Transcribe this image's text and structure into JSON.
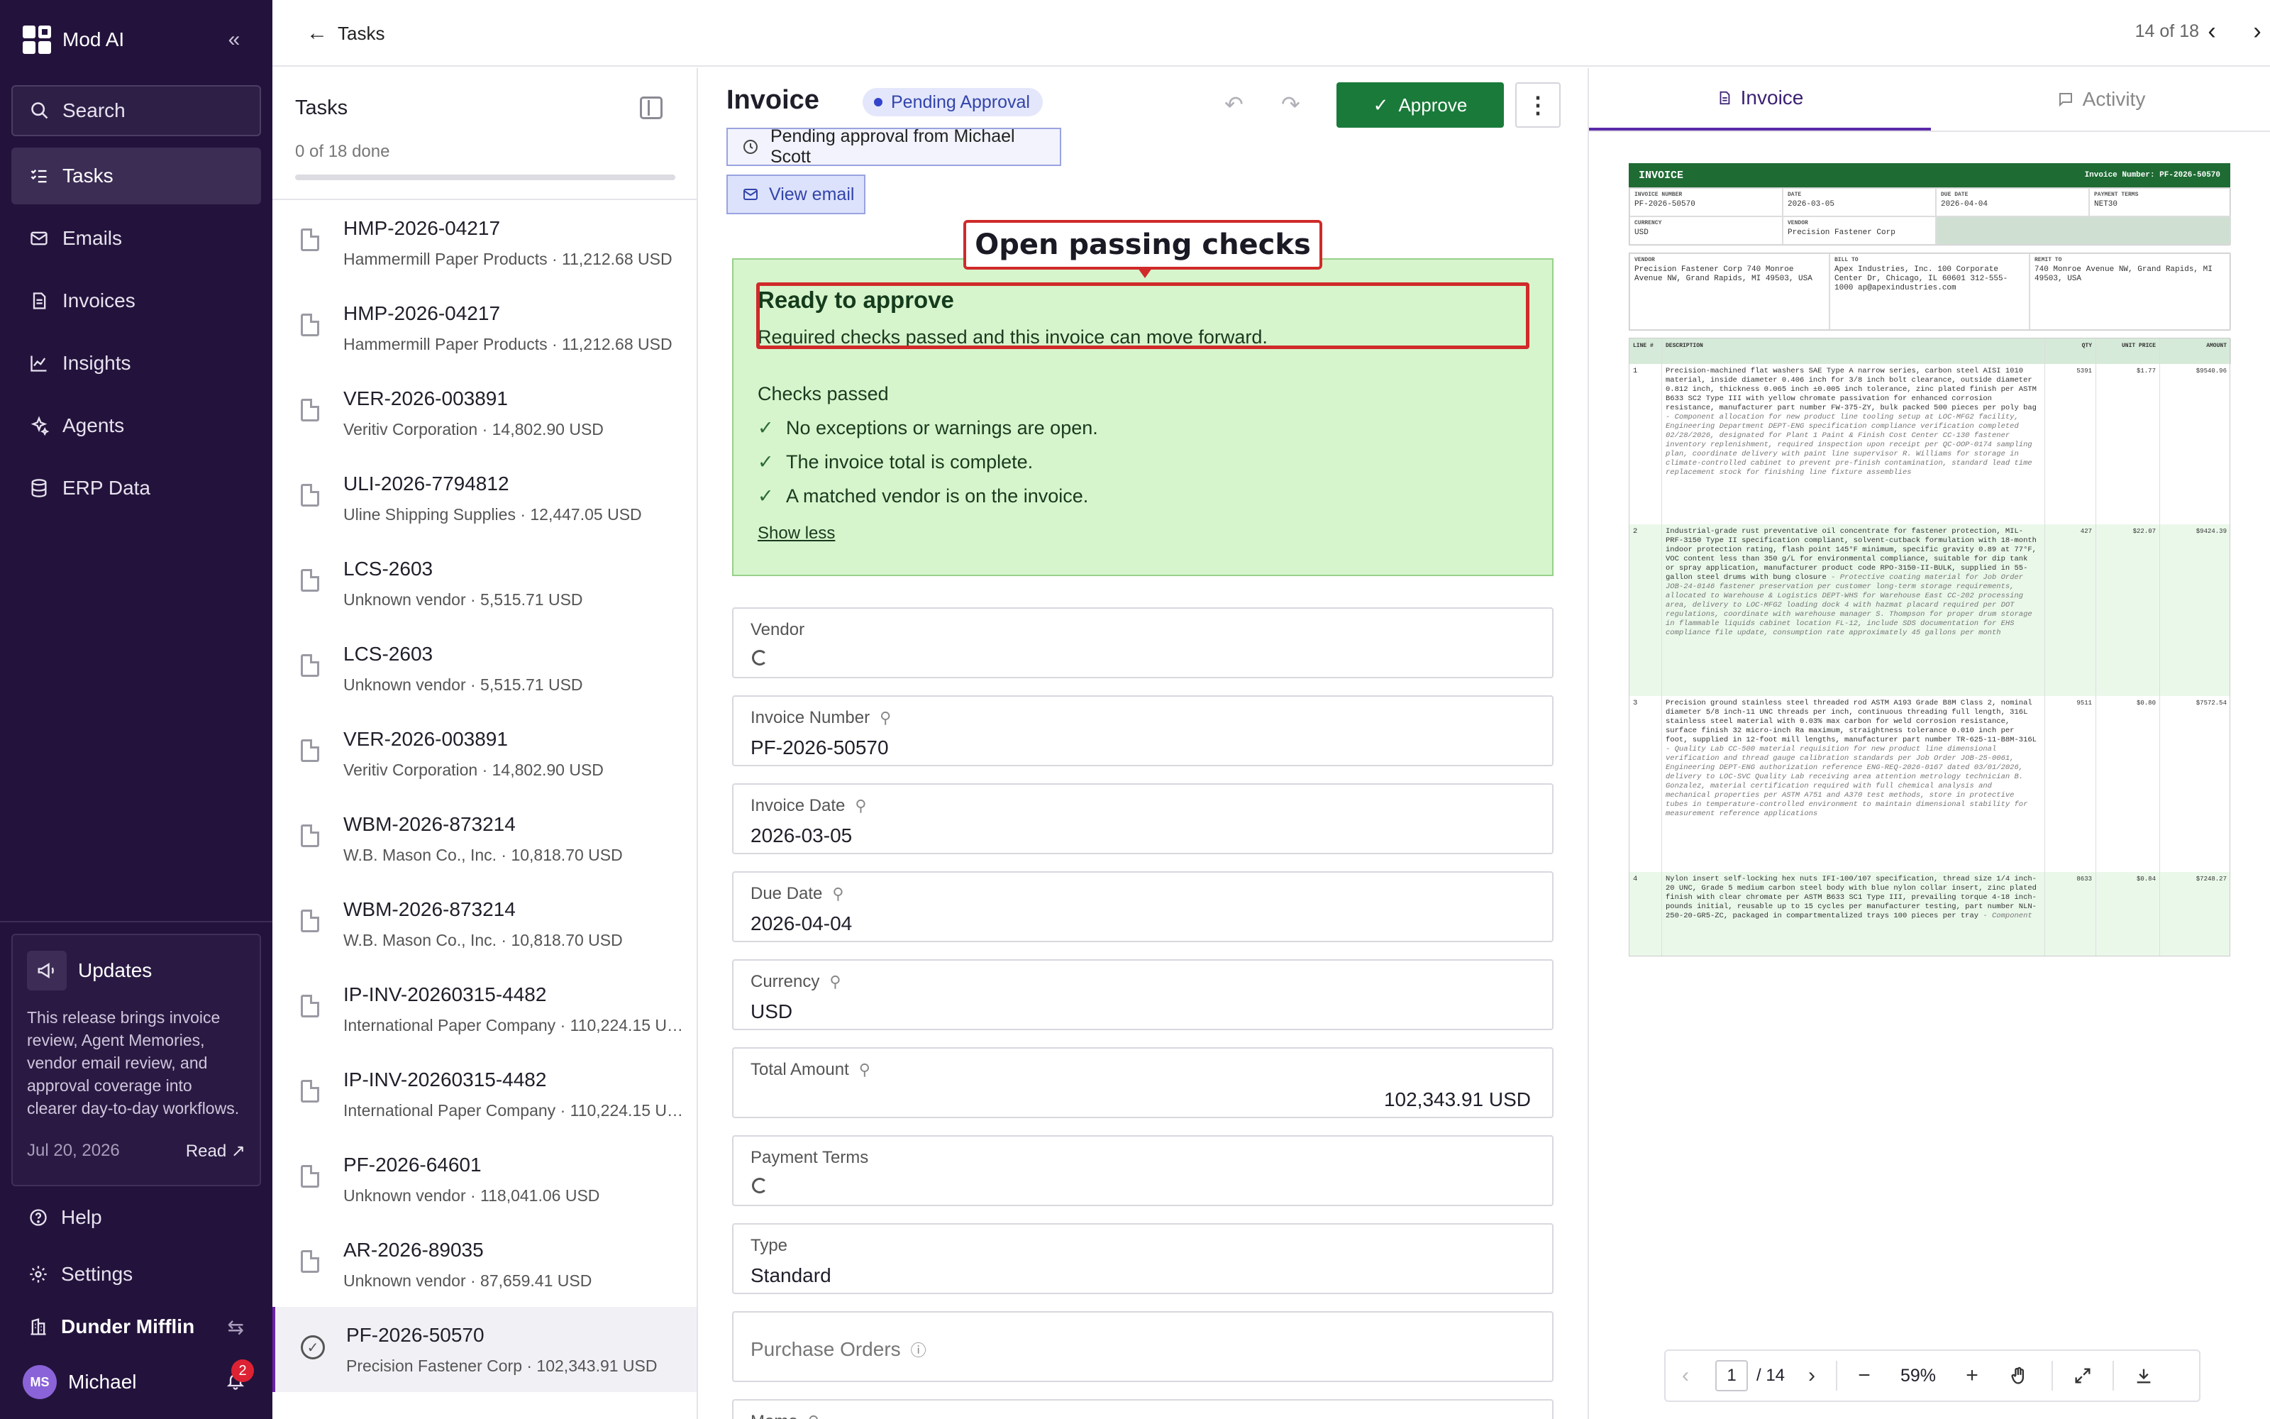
{
  "app": {
    "name": "Mod AI",
    "search_label": "Search"
  },
  "nav": [
    {
      "label": "Tasks",
      "icon": "tasks-icon",
      "active": true
    },
    {
      "label": "Emails",
      "icon": "mail-icon"
    },
    {
      "label": "Invoices",
      "icon": "invoice-icon"
    },
    {
      "label": "Insights",
      "icon": "chart-icon"
    },
    {
      "label": "Agents",
      "icon": "agents-icon"
    },
    {
      "label": "ERP Data",
      "icon": "database-icon"
    }
  ],
  "updates": {
    "title": "Updates",
    "body": "This release brings invoice review, Agent Memories, vendor email review, and approval coverage into clearer day-to-day workflows.",
    "date": "Jul 20, 2026",
    "read_label": "Read ↗"
  },
  "footer_nav": {
    "help": "Help",
    "settings": "Settings",
    "org": "Dunder Mifflin",
    "user_initials": "MS",
    "user_name": "Michael",
    "notification_count": "2"
  },
  "topbar": {
    "back_label": "Tasks",
    "pager_text": "14 of 18"
  },
  "tasks": {
    "title": "Tasks",
    "done_text": "0 of 18 done",
    "progress": 0,
    "items": [
      {
        "title": "HMP-2026-04217",
        "sub": "Hammermill Paper Products · 11,212.68 USD"
      },
      {
        "title": "HMP-2026-04217",
        "sub": "Hammermill Paper Products · 11,212.68 USD"
      },
      {
        "title": "VER-2026-003891",
        "sub": "Veritiv Corporation · 14,802.90 USD"
      },
      {
        "title": "ULI-2026-7794812",
        "sub": "Uline Shipping Supplies · 12,447.05 USD"
      },
      {
        "title": "LCS-2603",
        "sub": "Unknown vendor · 5,515.71 USD"
      },
      {
        "title": "LCS-2603",
        "sub": "Unknown vendor · 5,515.71 USD"
      },
      {
        "title": "VER-2026-003891",
        "sub": "Veritiv Corporation · 14,802.90 USD"
      },
      {
        "title": "WBM-2026-873214",
        "sub": "W.B. Mason Co., Inc. · 10,818.70 USD"
      },
      {
        "title": "WBM-2026-873214",
        "sub": "W.B. Mason Co., Inc. · 10,818.70 USD"
      },
      {
        "title": "IP-INV-20260315-4482",
        "sub": "International Paper Company · 110,224.15 USD"
      },
      {
        "title": "IP-INV-20260315-4482",
        "sub": "International Paper Company · 110,224.15 USD"
      },
      {
        "title": "PF-2026-64601",
        "sub": "Unknown vendor · 118,041.06 USD"
      },
      {
        "title": "AR-2026-89035",
        "sub": "Unknown vendor · 87,659.41 USD"
      },
      {
        "title": "PF-2026-50570",
        "sub": "Precision Fastener Corp · 102,343.91 USD",
        "selected": true
      }
    ]
  },
  "invoice": {
    "title": "Invoice",
    "status": "Pending Approval",
    "approve_label": "Approve",
    "pending_text": "Pending approval from Michael Scott",
    "view_email_label": "View email",
    "checks": {
      "ready_title": "Ready to approve",
      "ready_sub": "Required checks passed and this invoice can move forward.",
      "passed_title": "Checks passed",
      "items": [
        "No exceptions or warnings are open.",
        "The invoice total is complete.",
        "A matched vendor is on the invoice."
      ],
      "show_less": "Show less"
    },
    "annotation": "Open passing checks",
    "fields": [
      {
        "label": "Vendor",
        "value": "",
        "loading": true
      },
      {
        "label": "Invoice Number",
        "value": "PF-2026-50570",
        "search": true
      },
      {
        "label": "Invoice Date",
        "value": "2026-03-05",
        "search": true
      },
      {
        "label": "Due Date",
        "value": "2026-04-04",
        "search": true
      },
      {
        "label": "Currency",
        "value": "USD",
        "search": true
      },
      {
        "label": "Total Amount",
        "value": "102,343.91 USD",
        "search": true
      },
      {
        "label": "Payment Terms",
        "value": "",
        "loading": true
      },
      {
        "label": "Type",
        "value": "Standard"
      },
      {
        "label": "Purchase Orders",
        "value": ""
      },
      {
        "label": "Memo",
        "value": "",
        "search": true
      }
    ]
  },
  "right": {
    "tab_invoice": "Invoice",
    "tab_activity": "Activity",
    "page_current": "1",
    "page_total": "/ 14",
    "zoom": "59%"
  },
  "document": {
    "header_title": "INVOICE",
    "header_number": "Invoice Number: PF-2026-50570",
    "meta": [
      {
        "k": "INVOICE NUMBER",
        "v": "PF-2026-50570"
      },
      {
        "k": "DATE",
        "v": "2026-03-05"
      },
      {
        "k": "DUE DATE",
        "v": "2026-04-04"
      },
      {
        "k": "PAYMENT TERMS",
        "v": "NET30"
      },
      {
        "k": "CURRENCY",
        "v": "USD"
      },
      {
        "k": "VENDOR",
        "v": "Precision Fastener Corp"
      }
    ],
    "vendor": {
      "k": "VENDOR",
      "v": "Precision Fastener Corp 740 Monroe Avenue NW, Grand Rapids, MI 49503, USA"
    },
    "bill_to": {
      "k": "BILL TO",
      "v": "Apex Industries, Inc. 100 Corporate Center Dr, Chicago, IL 60601 312-555-1000 ap@apexindustries.com"
    },
    "remit_to": {
      "k": "REMIT TO",
      "v": "740 Monroe Avenue NW, Grand Rapids, MI 49503, USA"
    },
    "columns": [
      "LINE #",
      "DESCRIPTION",
      "QTY",
      "UNIT PRICE",
      "AMOUNT"
    ],
    "lines": [
      {
        "n": "1",
        "d": "Precision-machined flat washers SAE Type A narrow series, carbon steel AISI 1010 material, inside diameter 0.406 inch for 3/8 inch bolt clearance, outside diameter 0.812 inch, thickness 0.065 inch ±0.005 inch tolerance, zinc plated finish per ASTM B633 SC2 Type III with yellow chromate passivation for enhanced corrosion resistance, manufacturer part number FW-375-ZY, bulk packed 500 pieces per poly bag",
        "note": "- Component allocation for new product line tooling setup at LOC-MFG2 facility, Engineering Department DEPT-ENG specification compliance verification completed 02/28/2026, designated for Plant 1 Paint & Finish Cost Center CC-130 fastener inventory replenishment, required inspection upon receipt per QC-OOP-0174 sampling plan, coordinate delivery with paint line supervisor R. Williams for storage in climate-controlled cabinet to prevent pre-finish contamination, standard lead time replacement stock for finishing line fixture assemblies",
        "q": "5391",
        "p": "$1.77",
        "a": "$9540.96"
      },
      {
        "n": "2",
        "d": "Industrial-grade rust preventative oil concentrate for fastener protection, MIL-PRF-3150 Type II specification compliant, solvent-cutback formulation with 18-month indoor protection rating, flash point 145°F minimum, specific gravity 0.89 at 77°F, VOC content less than 350 g/L for environmental compliance, suitable for dip tank or spray application, manufacturer product code RPO-3150-II-BULK, supplied in 55-gallon steel drums with bung closure",
        "note": "- Protective coating material for Job Order JOB-24-0146 fastener preservation per customer long-term storage requirements, allocated to Warehouse & Logistics DEPT-WHS for Warehouse East CC-202 processing area, delivery to LOC-MFG2 loading dock 4 with hazmat placard required per DOT regulations, coordinate with warehouse manager S. Thompson for proper drum storage in flammable liquids cabinet location FL-12, include SDS documentation for EHS compliance file update, consumption rate approximately 45 gallons per month",
        "q": "427",
        "p": "$22.07",
        "a": "$9424.39"
      },
      {
        "n": "3",
        "d": "Precision ground stainless steel threaded rod ASTM A193 Grade B8M Class 2, nominal diameter 5/8 inch-11 UNC threads per inch, continuous threading full length, 316L stainless steel material with 0.03% max carbon for weld corrosion resistance, surface finish 32 micro-inch Ra maximum, straightness tolerance 0.010 inch per foot, supplied in 12-foot mill lengths, manufacturer part number TR-625-11-B8M-316L",
        "note": "- Quality Lab CC-500 material requisition for new product line dimensional verification and thread gauge calibration standards per Job Order JOB-25-0061, Engineering DEPT-ENG authorization reference ENG-REQ-2026-0167 dated 03/01/2026, delivery to LOC-SVC Quality Lab receiving area attention metrology technician B. Gonzalez, material certification required with full chemical analysis and mechanical properties per ASTM A751 and A370 test methods, store in protective tubes in temperature-controlled environment to maintain dimensional stability for measurement reference applications",
        "q": "9511",
        "p": "$0.80",
        "a": "$7572.54"
      },
      {
        "n": "4",
        "d": "Nylon insert self-locking hex nuts IFI-100/107 specification, thread size 1/4 inch-20 UNC, Grade 5 medium carbon steel body with blue nylon collar insert, zinc plated finish with clear chromate per ASTM B633 SC1 Type III, prevailing torque 4-18 inch-pounds initial, reusable up to 15 cycles per manufacturer testing, part number NLN-250-20-GR5-ZC, packaged in compartmentalized trays 100 pieces per tray",
        "note": "- Component",
        "q": "8633",
        "p": "$0.84",
        "a": "$7248.27"
      }
    ]
  }
}
